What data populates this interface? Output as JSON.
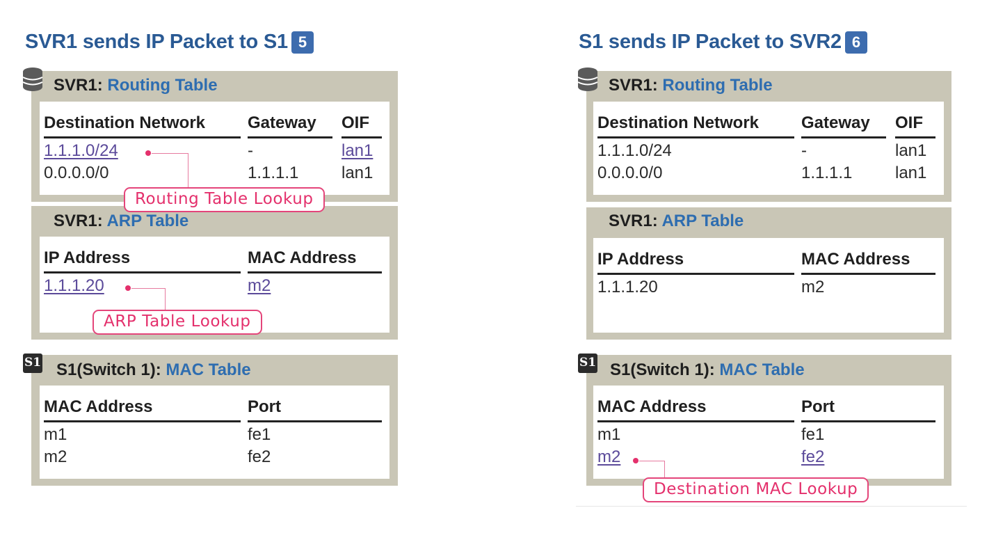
{
  "panels": [
    {
      "title": "SVR1 sends IP Packet to S1",
      "step": "5",
      "routing": {
        "owner": "SVR1:",
        "name": "Routing Table",
        "icon": "database-icon",
        "headers": [
          "Destination Network",
          "Gateway",
          "OIF"
        ],
        "rows": [
          [
            "1.1.1.0/24",
            "-",
            "lan1"
          ],
          [
            "0.0.0.0/0",
            "1.1.1.1",
            "lan1"
          ]
        ],
        "highlight_row": 0,
        "callout": "Routing Table Lookup"
      },
      "arp": {
        "owner": "SVR1:",
        "name": "ARP Table",
        "headers": [
          "IP Address",
          "MAC Address"
        ],
        "rows": [
          [
            "1.1.1.20",
            "m2"
          ]
        ],
        "highlight_row": 0,
        "callout": "ARP Table Lookup"
      },
      "mac": {
        "owner": "S1(Switch 1):",
        "name": "MAC Table",
        "icon": "switch-s1-icon",
        "icon_label": "S1",
        "headers": [
          "MAC Address",
          "Port"
        ],
        "rows": [
          [
            "m1",
            "fe1"
          ],
          [
            "m2",
            "fe2"
          ]
        ],
        "highlight_row": null,
        "callout": null
      }
    },
    {
      "title": "S1 sends IP Packet to SVR2",
      "step": "6",
      "routing": {
        "owner": "SVR1:",
        "name": "Routing Table",
        "icon": "database-icon",
        "headers": [
          "Destination Network",
          "Gateway",
          "OIF"
        ],
        "rows": [
          [
            "1.1.1.0/24",
            "-",
            "lan1"
          ],
          [
            "0.0.0.0/0",
            "1.1.1.1",
            "lan1"
          ]
        ],
        "highlight_row": null,
        "callout": null
      },
      "arp": {
        "owner": "SVR1:",
        "name": "ARP Table",
        "headers": [
          "IP Address",
          "MAC Address"
        ],
        "rows": [
          [
            "1.1.1.20",
            "m2"
          ]
        ],
        "highlight_row": null,
        "callout": null
      },
      "mac": {
        "owner": "S1(Switch 1):",
        "name": "MAC Table",
        "icon": "switch-s1-icon",
        "icon_label": "S1",
        "headers": [
          "MAC Address",
          "Port"
        ],
        "rows": [
          [
            "m1",
            "fe1"
          ],
          [
            "m2",
            "fe2"
          ]
        ],
        "highlight_row": 1,
        "callout": "Destination MAC Lookup"
      }
    }
  ],
  "colors": {
    "title": "#2a5a94",
    "step_badge": "#3d6cae",
    "table_name": "#2e6db0",
    "frame": "#c9c6b6",
    "callout": "#e4306c",
    "highlight_link": "#5b4a9a"
  }
}
